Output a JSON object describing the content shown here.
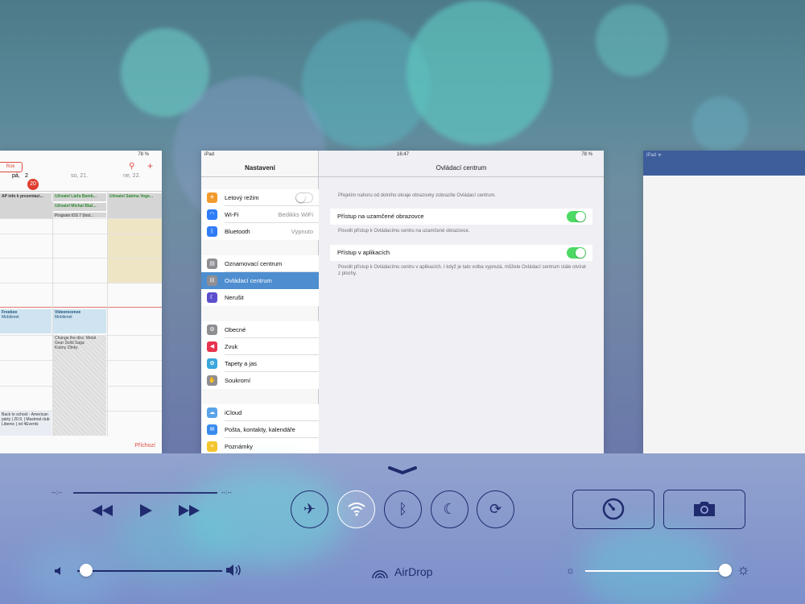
{
  "calendar_card": {
    "battery": "78 %",
    "year_button": "Rok",
    "search_icon": "⚲",
    "add_icon": "+",
    "days": [
      {
        "label": "pá,"
      },
      {
        "label": "so, 21."
      },
      {
        "label": "ne, 22."
      }
    ],
    "today_badge": "20",
    "today_prefix": "2",
    "allday_events": [
      "AP info k prezentaci...",
      "Uživatel Láďa Bamb...",
      "Uživatel Sabina Voge...",
      "Uživatel Michal Blaž...",
      "Program iOS 7 (Inst..."
    ],
    "events": [
      {
        "title": "Freebox",
        "sub": "Mobilenet"
      },
      {
        "title": "Videorecenze",
        "sub": "Mobilenet"
      },
      {
        "title": "Change the disc: Metal Gear Solid Saga",
        "sub": "Kubny Zlinky"
      },
      {
        "title": "Back to school - American párty | 20.9. | Maximal club Liberec | od 4Events",
        "sub": ""
      }
    ],
    "incoming_label": "Příchozí"
  },
  "settings_card": {
    "status_left": "iPad",
    "status_time": "16:47",
    "status_battery": "78 %",
    "sidebar_title": "Nastavení",
    "detail_title": "Ovládací centrum",
    "sidebar": [
      {
        "label": "Letový režim",
        "icon": "airplane-icon",
        "color": "#f29b2d",
        "glyph": "✈",
        "toggle": true
      },
      {
        "label": "Wi-Fi",
        "icon": "wifi-icon",
        "color": "#2f7cf6",
        "glyph": "◠",
        "value": "Bedikks WiFi"
      },
      {
        "label": "Bluetooth",
        "icon": "bluetooth-icon",
        "color": "#2f7cf6",
        "glyph": "ᛒ",
        "value": "Vypnuto"
      },
      {
        "label": "Oznamovací centrum",
        "icon": "notifications-icon",
        "color": "#8e8e93",
        "glyph": "▤"
      },
      {
        "label": "Ovládací centrum",
        "icon": "control-center-icon",
        "color": "#8e8e93",
        "glyph": "⊟",
        "selected": true
      },
      {
        "label": "Nerušit",
        "icon": "moon-icon",
        "color": "#5b4fcf",
        "glyph": "☾"
      },
      {
        "label": "Obecné",
        "icon": "gear-icon",
        "color": "#8e8e93",
        "glyph": "⚙"
      },
      {
        "label": "Zvuk",
        "icon": "speaker-icon",
        "color": "#e8344e",
        "glyph": "◀"
      },
      {
        "label": "Tapety a jas",
        "icon": "flower-icon",
        "color": "#3aa6dc",
        "glyph": "✿"
      },
      {
        "label": "Soukromí",
        "icon": "hand-icon",
        "color": "#8e8e93",
        "glyph": "✋"
      },
      {
        "label": "iCloud",
        "icon": "cloud-icon",
        "color": "#5aa3e8",
        "glyph": "☁"
      },
      {
        "label": "Pošta, kontakty, kalendáře",
        "icon": "mail-icon",
        "color": "#3a8bf0",
        "glyph": "✉"
      },
      {
        "label": "Poznámky",
        "icon": "notes-icon",
        "color": "#f5c52c",
        "glyph": "≡"
      }
    ],
    "detail": {
      "intro": "Přejetím nahoru od dolního okraje obrazovky zobrazíte Ovládací centrum.",
      "lock_label": "Přístup na uzamčené obrazovce",
      "lock_desc": "Povolit přístup k Ovládacímu centru na uzamčené obrazovce.",
      "apps_label": "Přístup v aplikacích",
      "apps_desc": "Povolit přístup k Ovládacímu centru v aplikacích. I když je tato volba vypnutá, můžete Ovládací centrum stále otvírat z plochy."
    }
  },
  "third_card": {
    "status": "iPad ᯤ"
  },
  "control_center": {
    "elapsed": "--:--",
    "remaining": "--:--",
    "airdrop_label": "AirDrop",
    "volume_level": 0.06,
    "brightness_level": 0.98,
    "toggles": [
      {
        "name": "airplane-mode-toggle",
        "glyph": "✈",
        "on": false
      },
      {
        "name": "wifi-toggle",
        "glyph": "wifi",
        "on": true
      },
      {
        "name": "bluetooth-toggle",
        "glyph": "ᛒ",
        "on": false
      },
      {
        "name": "do-not-disturb-toggle",
        "glyph": "☾",
        "on": false
      },
      {
        "name": "rotation-lock-toggle",
        "glyph": "⟳",
        "on": false
      }
    ],
    "accent": "#1f2b6e"
  }
}
